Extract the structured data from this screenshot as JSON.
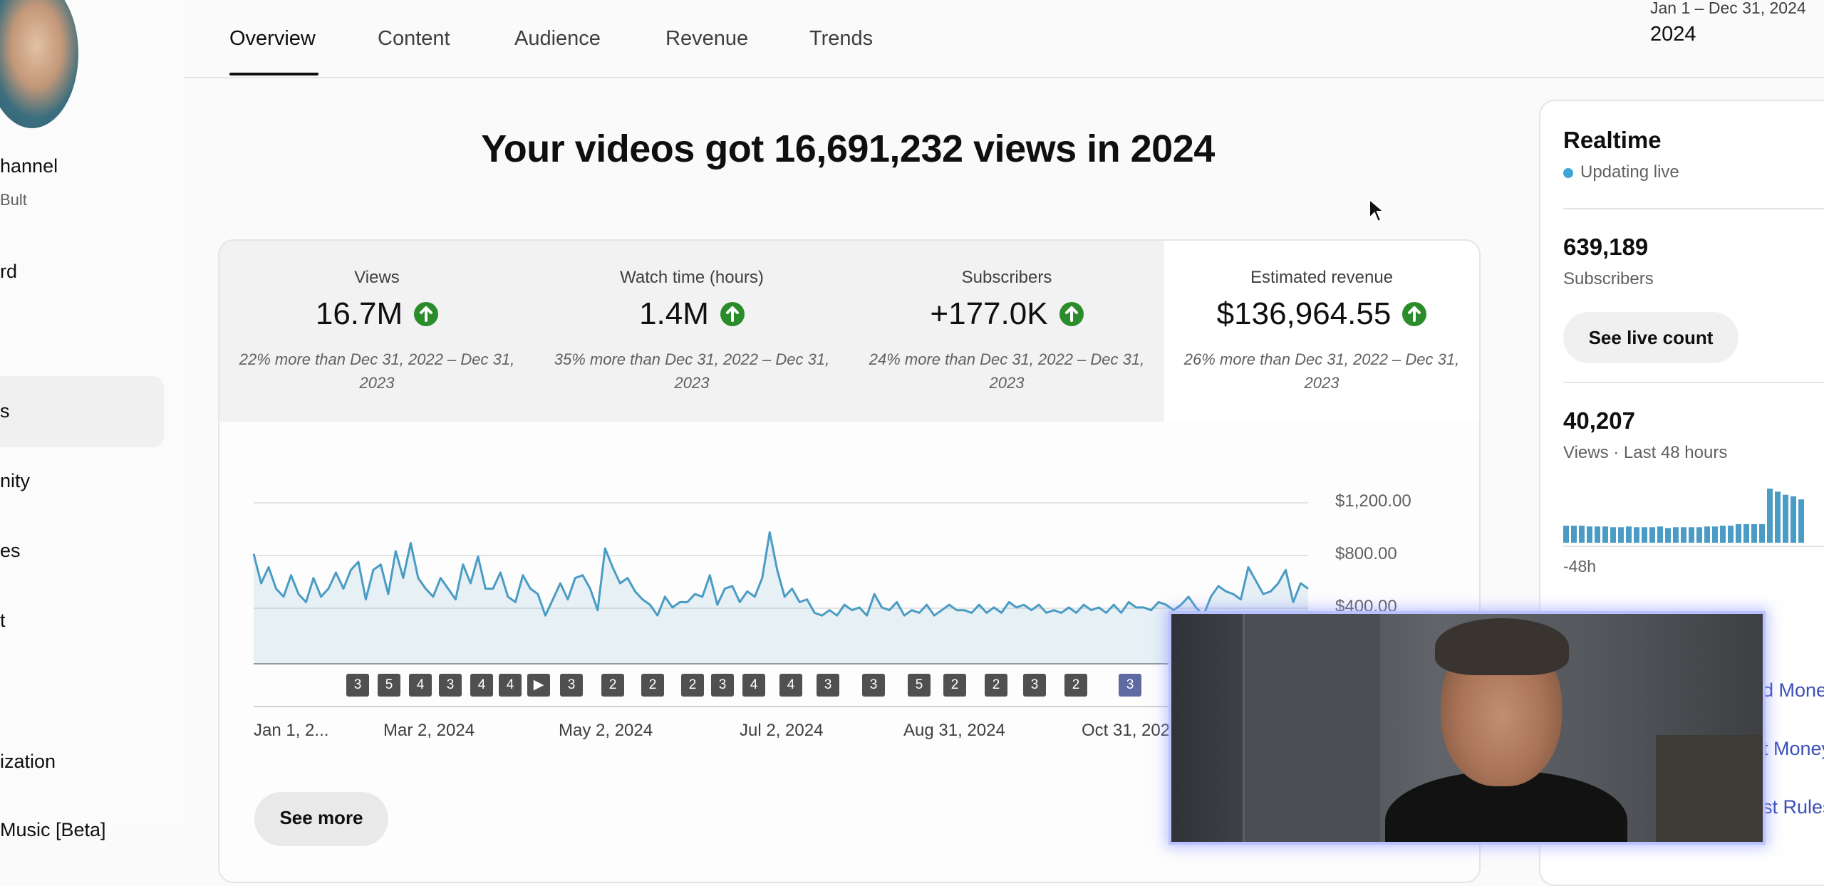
{
  "sidebar": {
    "channel_partial": "hannel",
    "owner_partial": "Bult",
    "items": [
      {
        "label": "rd"
      },
      {
        "label": "s"
      },
      {
        "label": "nity"
      },
      {
        "label": "es"
      },
      {
        "label": "t"
      },
      {
        "label": "ization"
      },
      {
        "label": "Music [Beta]"
      }
    ]
  },
  "tabs": [
    {
      "label": "Overview",
      "active": true
    },
    {
      "label": "Content"
    },
    {
      "label": "Audience"
    },
    {
      "label": "Revenue"
    },
    {
      "label": "Trends"
    }
  ],
  "date_range": {
    "label": "Jan 1 – Dec 31, 2024",
    "value": "2024"
  },
  "headline": "Your videos got 16,691,232 views in 2024",
  "metrics": [
    {
      "label": "Views",
      "value": "16.7M",
      "compare": "22% more than Dec 31, 2022 – Dec 31, 2023"
    },
    {
      "label": "Watch time (hours)",
      "value": "1.4M",
      "compare": "35% more than Dec 31, 2022 – Dec 31, 2023"
    },
    {
      "label": "Subscribers",
      "value": "+177.0K",
      "compare": "24% more than Dec 31, 2022 – Dec 31, 2023"
    },
    {
      "label": "Estimated revenue",
      "value": "$136,964.55",
      "compare": "26% more than Dec 31, 2022 – Dec 31, 2023"
    }
  ],
  "chart_data": {
    "type": "line",
    "y_ticks": [
      "$1,200.00",
      "$800.00",
      "$400.00"
    ],
    "x_ticks": [
      "Jan 1, 2...",
      "Mar 2, 2024",
      "May 2, 2024",
      "Jul 2, 2024",
      "Aug 31, 2024",
      "Oct 31, 202"
    ],
    "ylim": [
      0,
      1200
    ],
    "markers": [
      "3",
      "5",
      "4",
      "3",
      "4",
      "4",
      "▶",
      "3",
      "2",
      "2",
      "2",
      "3",
      "4",
      "4",
      "3",
      "3",
      "5",
      "2",
      "2",
      "3",
      "2",
      "3"
    ],
    "series": [
      {
        "color": "#4a9cc4",
        "values": [
          820,
          600,
          720,
          560,
          500,
          660,
          520,
          460,
          640,
          500,
          560,
          680,
          560,
          700,
          760,
          480,
          700,
          740,
          520,
          840,
          640,
          900,
          640,
          560,
          500,
          640,
          560,
          480,
          740,
          600,
          800,
          560,
          560,
          680,
          500,
          460,
          660,
          560,
          520,
          360,
          480,
          600,
          480,
          640,
          660,
          560,
          400,
          860,
          720,
          600,
          640,
          540,
          480,
          440,
          360,
          500,
          420,
          460,
          460,
          520,
          500,
          660,
          440,
          560,
          580,
          460,
          540,
          500,
          640,
          980,
          700,
          500,
          560,
          460,
          480,
          380,
          360,
          400,
          360,
          440,
          400,
          420,
          360,
          520,
          420,
          400,
          460,
          360,
          400,
          380,
          440,
          360,
          400,
          440,
          400,
          400,
          380,
          440,
          380,
          420,
          380,
          460,
          420,
          440,
          400,
          440,
          380,
          400,
          380,
          420,
          380,
          440,
          400,
          420,
          380,
          440,
          380,
          460,
          420,
          420,
          400,
          460,
          440,
          400,
          440,
          500,
          420,
          360,
          500,
          580,
          540,
          520,
          480,
          720,
          620,
          520,
          540,
          600,
          700,
          460,
          600,
          560
        ]
      }
    ]
  },
  "see_more": "See more",
  "realtime": {
    "title": "Realtime",
    "status": "Updating live",
    "subscribers_value": "639,189",
    "subscribers_label": "Subscribers",
    "see_live_count": "See live count",
    "views_value": "40,207",
    "views_label": "Views · Last 48 hours",
    "axis_label": "-48h",
    "bars": [
      22,
      22,
      22,
      21,
      21,
      21,
      20,
      20,
      21,
      20,
      20,
      20,
      21,
      19,
      20,
      20,
      20,
      20,
      21,
      21,
      22,
      22,
      24,
      24,
      24,
      24,
      70,
      66,
      62,
      60,
      56
    ]
  },
  "side_links": [
    "d Money",
    "t Money",
    "st Rules"
  ]
}
